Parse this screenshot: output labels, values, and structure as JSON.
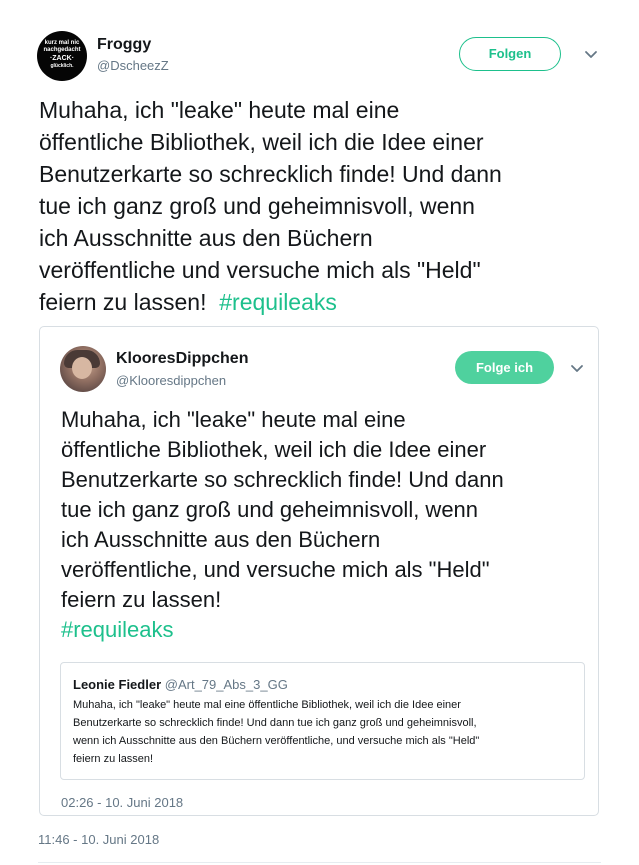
{
  "tweet": {
    "avatar_text": [
      "kurz mal nic",
      "nachgedacht",
      "·ZACK·",
      "glücklich."
    ],
    "name": "Froggy",
    "handle": "@DscheezZ",
    "follow_label": "Folgen",
    "text_lines": [
      "Muhaha, ich \"leake\" heute mal eine",
      "öffentliche Bibliothek, weil ich die  Idee einer",
      "Benutzerkarte so schrecklich finde! Und dann",
      "tue ich ganz groß und geheimnisvoll, wenn",
      "ich Ausschnitte aus den Büchern",
      "veröffentliche und versuche mich als \"Held\"",
      "feiern zu lassen!  "
    ],
    "hashtag": "#requileaks",
    "timestamp": "11:46 - 10. Juni 2018"
  },
  "quoted": {
    "name": "KlooresDippchen",
    "handle": "@Klooresdippchen",
    "follow_label": "Folge ich",
    "text_lines": [
      "Muhaha, ich \"leake\" heute mal eine",
      "öffentliche Bibliothek, weil ich die Idee einer",
      "Benutzerkarte so schrecklich finde! Und dann",
      "tue ich ganz groß und geheimnisvoll, wenn",
      "ich Ausschnitte aus den Büchern",
      "veröffentliche, und versuche mich als \"Held\"",
      "feiern zu lassen!"
    ],
    "hashtag": "#requileaks",
    "timestamp": "02:26 - 10. Juni 2018"
  },
  "nested": {
    "name": "Leonie Fiedler",
    "handle": "@Art_79_Abs_3_GG",
    "text_lines": [
      "Muhaha, ich \"leake\" heute mal eine öffentliche Bibliothek, weil ich die Idee einer",
      "Benutzerkarte so schrecklich finde! Und dann tue ich ganz groß und geheimnisvoll,",
      "wenn ich Ausschnitte aus den Büchern veröffentliche, und versuche mich als \"Held\"",
      "feiern zu lassen!"
    ]
  },
  "icons": {
    "chevron": "chevron-down-icon"
  },
  "colors": {
    "accent": "#1dc08c",
    "follow_filled_bg": "#4fd19e",
    "muted": "#657786",
    "border": "#d8dee3"
  }
}
